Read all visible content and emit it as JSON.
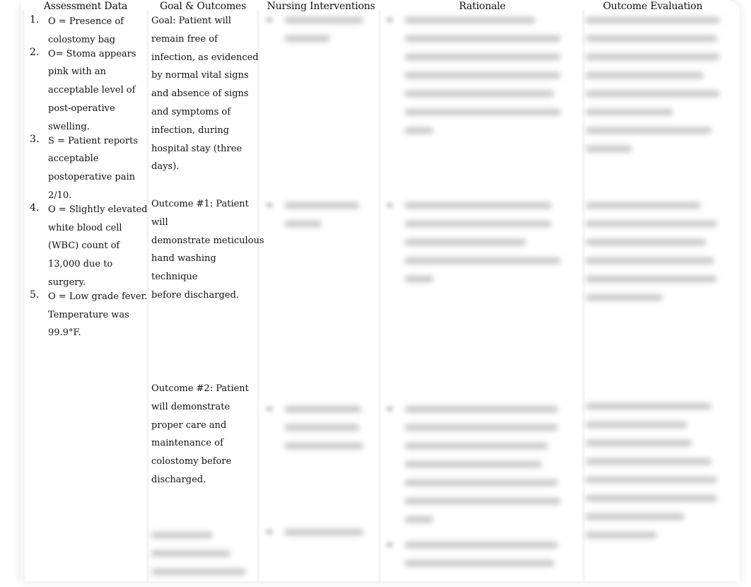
{
  "table": {
    "headers": [
      "Assessment Data",
      "Goal & Outcomes",
      "Nursing Interventions",
      "Rationale",
      "Outcome Evaluation"
    ],
    "assessment_data": [
      {
        "num": "1.",
        "lines": [
          "O = Presence of",
          "colostomy bag"
        ]
      },
      {
        "num": "2.",
        "lines": [
          "O= Stoma appears",
          "pink with an",
          "acceptable level of",
          "post-operative",
          "swelling."
        ]
      },
      {
        "num": "3.",
        "lines": [
          "S = Patient reports",
          "acceptable",
          "postoperative pain",
          "2/10."
        ]
      },
      {
        "num": "4.",
        "lines": [
          "O = Slightly elevated",
          "white blood cell",
          "(WBC) count of",
          "13,000 due to",
          "surgery."
        ]
      },
      {
        "num": "5.",
        "lines": [
          "O = Low grade fever.",
          "Temperature was",
          "99.9°F."
        ]
      }
    ],
    "goals": [
      {
        "lines": [
          "Goal: Patient will",
          "remain free of",
          "infection, as evidenced",
          "by normal vital signs",
          "and absence of signs",
          "and symptoms of",
          "infection, during",
          "hospital stay (three",
          "days)."
        ]
      },
      {
        "lines": [
          "Outcome #1: Patient will",
          "demonstrate meticulous",
          "hand washing technique",
          "before discharged."
        ]
      },
      {
        "lines": [
          "Outcome #2: Patient",
          "will demonstrate",
          "proper care and",
          "maintenance of",
          "colostomy before",
          "discharged."
        ]
      }
    ],
    "obscured_note": "Nursing Interventions, Rationale and Outcome Evaluation cell contents are blurred and unreadable"
  }
}
